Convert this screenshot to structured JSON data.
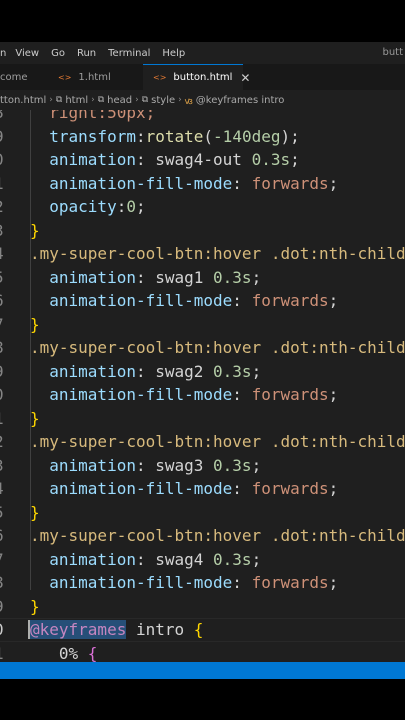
{
  "menu": {
    "items": [
      "n",
      "View",
      "Go",
      "Run",
      "Terminal",
      "Help"
    ],
    "window_title": "butt"
  },
  "tabs": [
    {
      "label": "come",
      "icon": "",
      "active": false
    },
    {
      "label": "1.html",
      "icon": "html-file-icon",
      "active": false
    },
    {
      "label": "button.html",
      "icon": "html-file-icon",
      "active": true,
      "close": "✕"
    }
  ],
  "breadcrumb": [
    "tton.html",
    "html",
    "head",
    "style",
    "@keyframes intro"
  ],
  "editor": {
    "lines": [
      {
        "ln": "8",
        "tokens": [
          {
            "t": "  right:50px;",
            "c": "#ce9178"
          }
        ]
      },
      {
        "ln": "9",
        "tokens": [
          {
            "t": "  transform",
            "c": "#9cdcfe"
          },
          {
            "t": ":",
            "c": "#d4d4d4"
          },
          {
            "t": "rotate",
            "c": "#dcdcaa"
          },
          {
            "t": "(",
            "c": "#d4d4d4"
          },
          {
            "t": "-140deg",
            "c": "#b5cea8"
          },
          {
            "t": ");",
            "c": "#d4d4d4"
          }
        ]
      },
      {
        "ln": "0",
        "tokens": [
          {
            "t": "  animation",
            "c": "#9cdcfe"
          },
          {
            "t": ": ",
            "c": "#d4d4d4"
          },
          {
            "t": "swag4-out ",
            "c": "#d4d4d4"
          },
          {
            "t": "0.3s",
            "c": "#b5cea8"
          },
          {
            "t": ";",
            "c": "#d4d4d4"
          }
        ]
      },
      {
        "ln": "1",
        "tokens": [
          {
            "t": "  animation-fill-mode",
            "c": "#9cdcfe"
          },
          {
            "t": ": ",
            "c": "#d4d4d4"
          },
          {
            "t": "forwards",
            "c": "#ce9178"
          },
          {
            "t": ";",
            "c": "#d4d4d4"
          }
        ]
      },
      {
        "ln": "2",
        "tokens": [
          {
            "t": "  opacity",
            "c": "#9cdcfe"
          },
          {
            "t": ":",
            "c": "#d4d4d4"
          },
          {
            "t": "0",
            "c": "#b5cea8"
          },
          {
            "t": ";",
            "c": "#d4d4d4"
          }
        ]
      },
      {
        "ln": "3",
        "tokens": [
          {
            "t": "}",
            "c": "#ffd700"
          }
        ]
      },
      {
        "ln": "4",
        "tokens": [
          {
            "t": ".my-super-cool-btn",
            "c": "#d7ba7d"
          },
          {
            "t": ":hover ",
            "c": "#d7ba7d"
          },
          {
            "t": ".dot",
            "c": "#d7ba7d"
          },
          {
            "t": ":nth-child",
            "c": "#d7ba7d"
          }
        ]
      },
      {
        "ln": "5",
        "tokens": [
          {
            "t": "  animation",
            "c": "#9cdcfe"
          },
          {
            "t": ": ",
            "c": "#d4d4d4"
          },
          {
            "t": "swag1 ",
            "c": "#d4d4d4"
          },
          {
            "t": "0.3s",
            "c": "#b5cea8"
          },
          {
            "t": ";",
            "c": "#d4d4d4"
          }
        ]
      },
      {
        "ln": "6",
        "tokens": [
          {
            "t": "  animation-fill-mode",
            "c": "#9cdcfe"
          },
          {
            "t": ": ",
            "c": "#d4d4d4"
          },
          {
            "t": "forwards",
            "c": "#ce9178"
          },
          {
            "t": ";",
            "c": "#d4d4d4"
          }
        ]
      },
      {
        "ln": "7",
        "tokens": [
          {
            "t": "}",
            "c": "#ffd700"
          }
        ]
      },
      {
        "ln": "8",
        "tokens": [
          {
            "t": ".my-super-cool-btn",
            "c": "#d7ba7d"
          },
          {
            "t": ":hover ",
            "c": "#d7ba7d"
          },
          {
            "t": ".dot",
            "c": "#d7ba7d"
          },
          {
            "t": ":nth-child",
            "c": "#d7ba7d"
          }
        ]
      },
      {
        "ln": "9",
        "tokens": [
          {
            "t": "  animation",
            "c": "#9cdcfe"
          },
          {
            "t": ": ",
            "c": "#d4d4d4"
          },
          {
            "t": "swag2 ",
            "c": "#d4d4d4"
          },
          {
            "t": "0.3s",
            "c": "#b5cea8"
          },
          {
            "t": ";",
            "c": "#d4d4d4"
          }
        ]
      },
      {
        "ln": "0",
        "tokens": [
          {
            "t": "  animation-fill-mode",
            "c": "#9cdcfe"
          },
          {
            "t": ": ",
            "c": "#d4d4d4"
          },
          {
            "t": "forwards",
            "c": "#ce9178"
          },
          {
            "t": ";",
            "c": "#d4d4d4"
          }
        ]
      },
      {
        "ln": "1",
        "tokens": [
          {
            "t": "}",
            "c": "#ffd700"
          }
        ]
      },
      {
        "ln": "2",
        "tokens": [
          {
            "t": ".my-super-cool-btn",
            "c": "#d7ba7d"
          },
          {
            "t": ":hover ",
            "c": "#d7ba7d"
          },
          {
            "t": ".dot",
            "c": "#d7ba7d"
          },
          {
            "t": ":nth-child",
            "c": "#d7ba7d"
          }
        ]
      },
      {
        "ln": "3",
        "tokens": [
          {
            "t": "  animation",
            "c": "#9cdcfe"
          },
          {
            "t": ": ",
            "c": "#d4d4d4"
          },
          {
            "t": "swag3 ",
            "c": "#d4d4d4"
          },
          {
            "t": "0.3s",
            "c": "#b5cea8"
          },
          {
            "t": ";",
            "c": "#d4d4d4"
          }
        ]
      },
      {
        "ln": "4",
        "tokens": [
          {
            "t": "  animation-fill-mode",
            "c": "#9cdcfe"
          },
          {
            "t": ": ",
            "c": "#d4d4d4"
          },
          {
            "t": "forwards",
            "c": "#ce9178"
          },
          {
            "t": ";",
            "c": "#d4d4d4"
          }
        ]
      },
      {
        "ln": "5",
        "tokens": [
          {
            "t": "}",
            "c": "#ffd700"
          }
        ]
      },
      {
        "ln": "6",
        "tokens": [
          {
            "t": ".my-super-cool-btn",
            "c": "#d7ba7d"
          },
          {
            "t": ":hover ",
            "c": "#d7ba7d"
          },
          {
            "t": ".dot",
            "c": "#d7ba7d"
          },
          {
            "t": ":nth-child",
            "c": "#d7ba7d"
          }
        ]
      },
      {
        "ln": "7",
        "tokens": [
          {
            "t": "  animation",
            "c": "#9cdcfe"
          },
          {
            "t": ": ",
            "c": "#d4d4d4"
          },
          {
            "t": "swag4 ",
            "c": "#d4d4d4"
          },
          {
            "t": "0.3s",
            "c": "#b5cea8"
          },
          {
            "t": ";",
            "c": "#d4d4d4"
          }
        ]
      },
      {
        "ln": "8",
        "tokens": [
          {
            "t": "  animation-fill-mode",
            "c": "#9cdcfe"
          },
          {
            "t": ": ",
            "c": "#d4d4d4"
          },
          {
            "t": "forwards",
            "c": "#ce9178"
          },
          {
            "t": ";",
            "c": "#d4d4d4"
          }
        ]
      },
      {
        "ln": "9",
        "tokens": [
          {
            "t": "}",
            "c": "#ffd700"
          }
        ]
      },
      {
        "ln": "0",
        "current": true,
        "tokens": [
          {
            "t": "@keyframes",
            "c": "#c586c0",
            "sel": true
          },
          {
            "t": " ",
            "c": "#d4d4d4"
          },
          {
            "t": "intro",
            "c": "#d4d4d4"
          },
          {
            "t": " ",
            "c": "#d4d4d4"
          },
          {
            "t": "{",
            "c": "#ffd700"
          }
        ]
      },
      {
        "ln": "1",
        "tokens": [
          {
            "t": "   0% ",
            "c": "#d4d4d4"
          },
          {
            "t": "{",
            "c": "#da70d6"
          }
        ]
      }
    ]
  },
  "colors": {
    "accent": "#0078d4",
    "editor_bg": "#1f1f1f",
    "selection": "#264f78"
  }
}
